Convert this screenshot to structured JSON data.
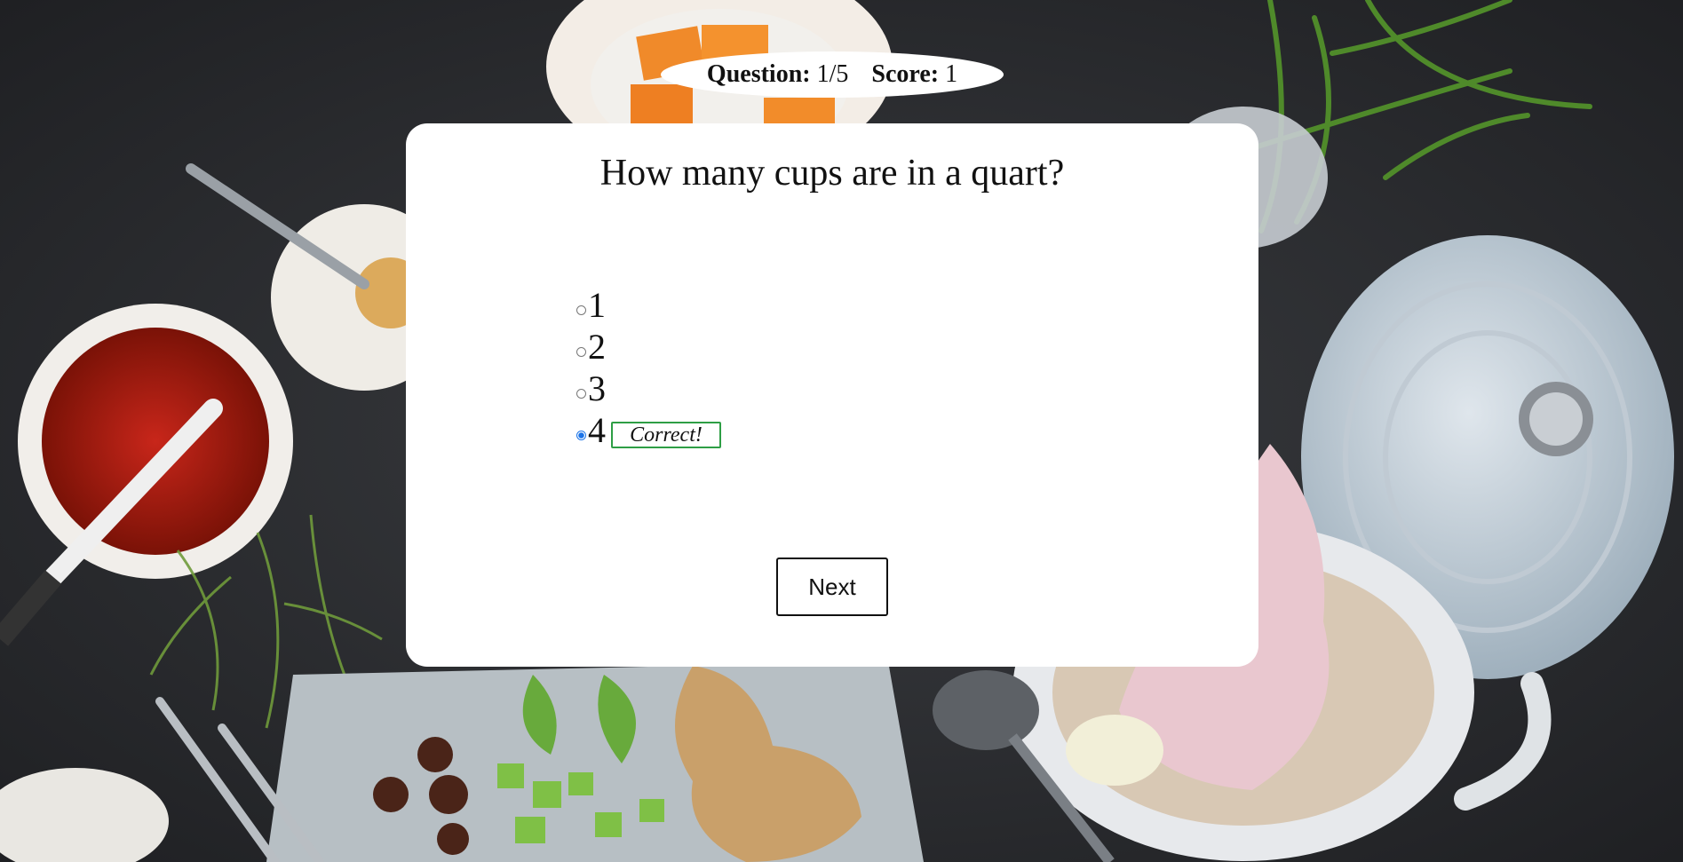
{
  "status": {
    "question_label": "Question:",
    "question_value": "1/5",
    "score_label": "Score:",
    "score_value": "1"
  },
  "quiz": {
    "question": "How many cups are in a quart?",
    "answers": [
      {
        "label": "1",
        "selected": false
      },
      {
        "label": "2",
        "selected": false
      },
      {
        "label": "3",
        "selected": false
      },
      {
        "label": "4",
        "selected": true
      }
    ],
    "feedback": "Correct!",
    "next_label": "Next"
  },
  "colors": {
    "card_background": "#ffffff",
    "feedback_border": "#2e9e45",
    "radio_selected": "#1a73e8",
    "page_background": "#2b2d30"
  }
}
